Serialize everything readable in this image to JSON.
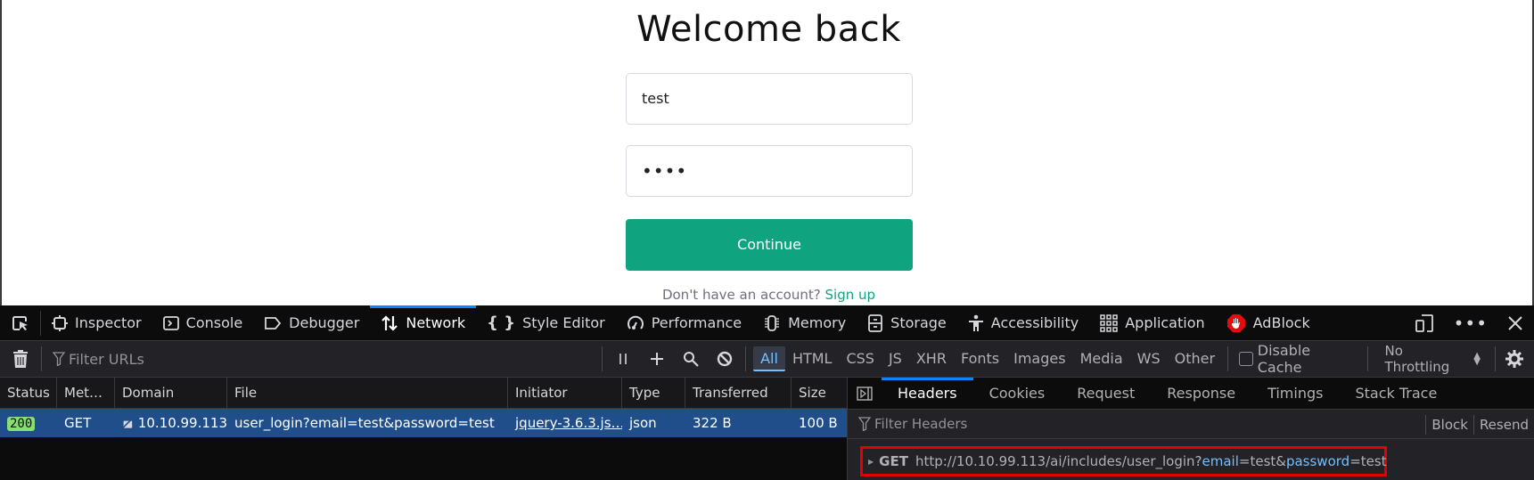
{
  "page": {
    "title": "Welcome back",
    "email_value": "test",
    "password_value": "••••",
    "continue_label": "Continue",
    "signup_prompt": "Don't have an account?",
    "signup_link": "Sign up",
    "accent": "#10a37f"
  },
  "devtools": {
    "tabs": [
      {
        "label": "Inspector",
        "icon": "inspector-icon"
      },
      {
        "label": "Console",
        "icon": "console-icon"
      },
      {
        "label": "Debugger",
        "icon": "debugger-icon"
      },
      {
        "label": "Network",
        "icon": "network-icon",
        "active": true
      },
      {
        "label": "Style Editor",
        "icon": "style-editor-icon"
      },
      {
        "label": "Performance",
        "icon": "performance-icon"
      },
      {
        "label": "Memory",
        "icon": "memory-icon"
      },
      {
        "label": "Storage",
        "icon": "storage-icon"
      },
      {
        "label": "Accessibility",
        "icon": "accessibility-icon"
      },
      {
        "label": "Application",
        "icon": "application-icon"
      },
      {
        "label": "AdBlock",
        "icon": "adblock-icon"
      }
    ],
    "toolbar": {
      "filter_placeholder": "Filter URLs",
      "types": [
        "All",
        "HTML",
        "CSS",
        "JS",
        "XHR",
        "Fonts",
        "Images",
        "Media",
        "WS",
        "Other"
      ],
      "active_type": "All",
      "disable_cache_label": "Disable Cache",
      "disable_cache_checked": false,
      "throttling": "No Throttling"
    },
    "table": {
      "columns": [
        "Status",
        "Met…",
        "Domain",
        "File",
        "Initiator",
        "Type",
        "Transferred",
        "Size"
      ],
      "rows": [
        {
          "status": "200",
          "method": "GET",
          "domain": "10.10.99.113",
          "file": "user_login?email=test&password=test",
          "initiator": "jquery-3.6.3.js…",
          "type": "json",
          "transferred": "322 B",
          "size": "100 B"
        }
      ]
    },
    "details": {
      "tabs": [
        "Headers",
        "Cookies",
        "Request",
        "Response",
        "Timings",
        "Stack Trace"
      ],
      "active_tab": "Headers",
      "filter_placeholder": "Filter Headers",
      "block_label": "Block",
      "resend_label": "Resend",
      "request_method": "GET",
      "url_base": "http://10.10.99.113/ai/includes/user_login?",
      "param1_key": "email",
      "param1_val": "=test&",
      "param2_key": "password",
      "param2_val": "=test"
    }
  }
}
